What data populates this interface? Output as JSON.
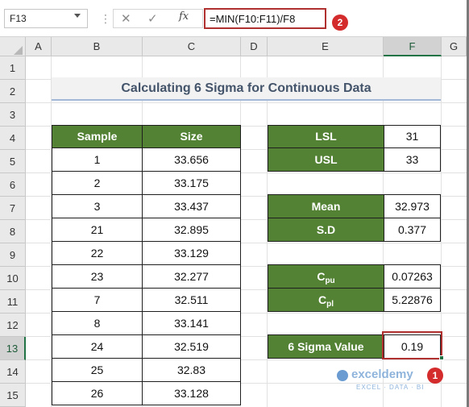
{
  "formula_bar": {
    "name_box": "F13",
    "cancel_icon": "✕",
    "enter_icon": "✓",
    "fx_icon": "fx",
    "formula": "=MIN(F10:F11)/F8",
    "badge": "2"
  },
  "columns": [
    "A",
    "B",
    "C",
    "D",
    "E",
    "F",
    "G"
  ],
  "rows": [
    "1",
    "2",
    "3",
    "4",
    "5",
    "6",
    "7",
    "8",
    "9",
    "10",
    "11",
    "12",
    "13",
    "14",
    "15"
  ],
  "selected_cell": "F13",
  "title": "Calculating 6 Sigma for Continuous Data",
  "sample_table": {
    "headers": [
      "Sample",
      "Size"
    ],
    "rows": [
      [
        "1",
        "33.656"
      ],
      [
        "2",
        "33.175"
      ],
      [
        "3",
        "33.437"
      ],
      [
        "21",
        "32.895"
      ],
      [
        "22",
        "33.129"
      ],
      [
        "23",
        "32.277"
      ],
      [
        "7",
        "32.511"
      ],
      [
        "8",
        "33.141"
      ],
      [
        "24",
        "32.519"
      ],
      [
        "25",
        "32.83"
      ],
      [
        "26",
        "33.128"
      ]
    ]
  },
  "limits": {
    "lsl_label": "LSL",
    "lsl_value": "31",
    "usl_label": "USL",
    "usl_value": "33"
  },
  "stats": {
    "mean_label": "Mean",
    "mean_value": "32.973",
    "sd_label": "S.D",
    "sd_value": "0.377"
  },
  "capability": {
    "cpu_label": "C",
    "cpu_sub": "pu",
    "cpu_value": "0.07263",
    "cpl_label": "C",
    "cpl_sub": "pl",
    "cpl_value": "5.22876"
  },
  "sigma": {
    "label": "6 Sigma Value",
    "value": "0.19",
    "badge": "1"
  },
  "watermark": {
    "name": "exceldemy",
    "tagline": "EXCEL · DATA · BI"
  },
  "colors": {
    "header_green": "#548235",
    "title_text": "#44546a",
    "highlight_red": "#b03030",
    "badge_red": "#d42c2c"
  }
}
